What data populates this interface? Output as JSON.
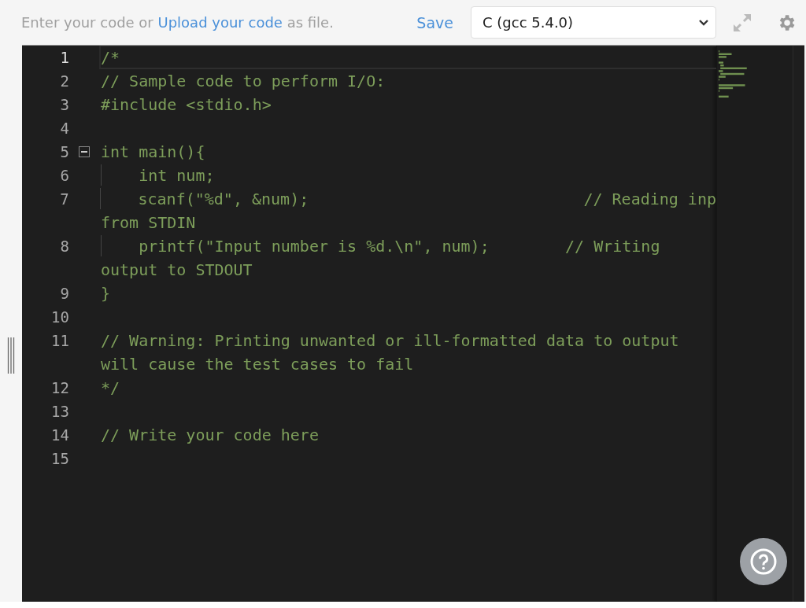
{
  "toolbar": {
    "prompt": {
      "before": "Enter your code or ",
      "link": "Upload your code",
      "after": " as file."
    },
    "save": "Save",
    "language": "C (gcc 5.4.0)"
  },
  "editor": {
    "lines": [
      {
        "number": "1",
        "active": true,
        "rows": [
          "/*"
        ]
      },
      {
        "number": "2",
        "active": false,
        "rows": [
          "// Sample code to perform I/O:"
        ]
      },
      {
        "number": "3",
        "active": false,
        "rows": [
          "#include <stdio.h>"
        ]
      },
      {
        "number": "4",
        "active": false
      },
      {
        "number": "5",
        "active": false,
        "expanded": true,
        "rows": [
          "int main(){"
        ]
      },
      {
        "number": "6",
        "active": false,
        "guide": true,
        "rows": [
          "    int num;"
        ]
      },
      {
        "number": "7",
        "active": false,
        "guide": true,
        "rows": [
          "    scanf(\"%d\", &num);                             // Reading inp",
          "from STDIN"
        ]
      },
      {
        "number": "8",
        "active": false,
        "guide": true,
        "rows": [
          "    printf(\"Input number is %d.\\n\", num);        // Writing",
          "output to STDOUT"
        ]
      },
      {
        "number": "9",
        "active": false,
        "rows": [
          "}"
        ]
      },
      {
        "number": "10",
        "active": false
      },
      {
        "number": "11",
        "active": false,
        "rows": [
          "// Warning: Printing unwanted or ill-formatted data to output",
          "will cause the test cases to fail"
        ]
      },
      {
        "number": "12",
        "active": false,
        "rows": [
          "*/"
        ]
      },
      {
        "number": "13",
        "active": false
      },
      {
        "number": "14",
        "active": false,
        "rows": [
          "// Write your code here"
        ]
      },
      {
        "number": "15",
        "active": false
      }
    ]
  }
}
